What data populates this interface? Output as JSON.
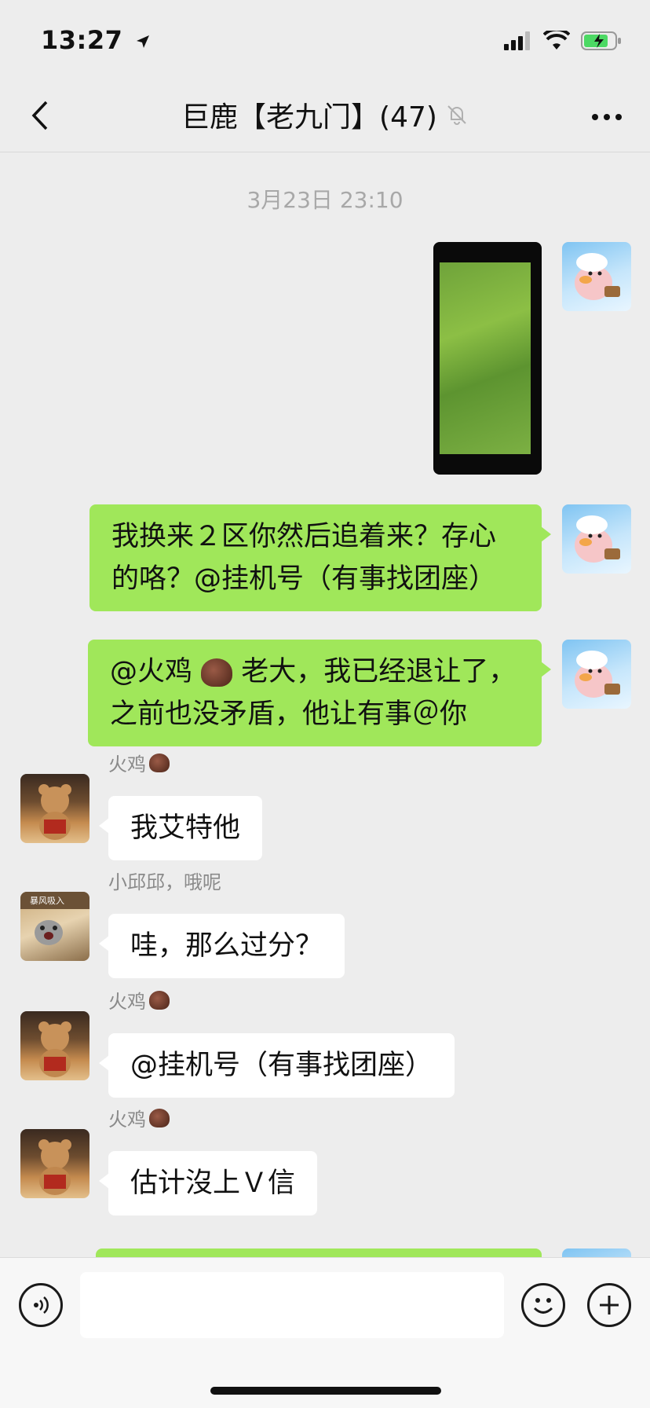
{
  "status_bar": {
    "time": "13:27"
  },
  "header": {
    "title": "巨鹿【老九门】(47)"
  },
  "chat": {
    "timestamp": "3月23日 23:10",
    "messages": [
      {
        "from": "me",
        "type": "image"
      },
      {
        "from": "me",
        "type": "text",
        "text_line1": "我换来２区你然后追着来？存心",
        "text_line2": "的咯？@挂机号（有事找团座）"
      },
      {
        "from": "me",
        "type": "text",
        "text_line1_a": "@火鸡",
        "text_line1_b": "老大，我已经退让了，",
        "text_line2": "之前也没矛盾，他让有事＠你"
      },
      {
        "from": "other",
        "sender": "火鸡",
        "text": "我艾特他"
      },
      {
        "from": "other",
        "sender": "小邱邱，哦呢",
        "text": "哇，那么过分？",
        "avatar_caption": "暴风吸入"
      },
      {
        "from": "other",
        "sender": "火鸡",
        "text": "@挂机号（有事找团座）"
      },
      {
        "from": "other",
        "sender": "火鸡",
        "text": "估计沒上Ｖ信"
      }
    ]
  },
  "input": {
    "placeholder": ""
  },
  "colors": {
    "self_bubble": "#a0e75a",
    "other_bubble": "#ffffff",
    "background": "#ededed"
  }
}
